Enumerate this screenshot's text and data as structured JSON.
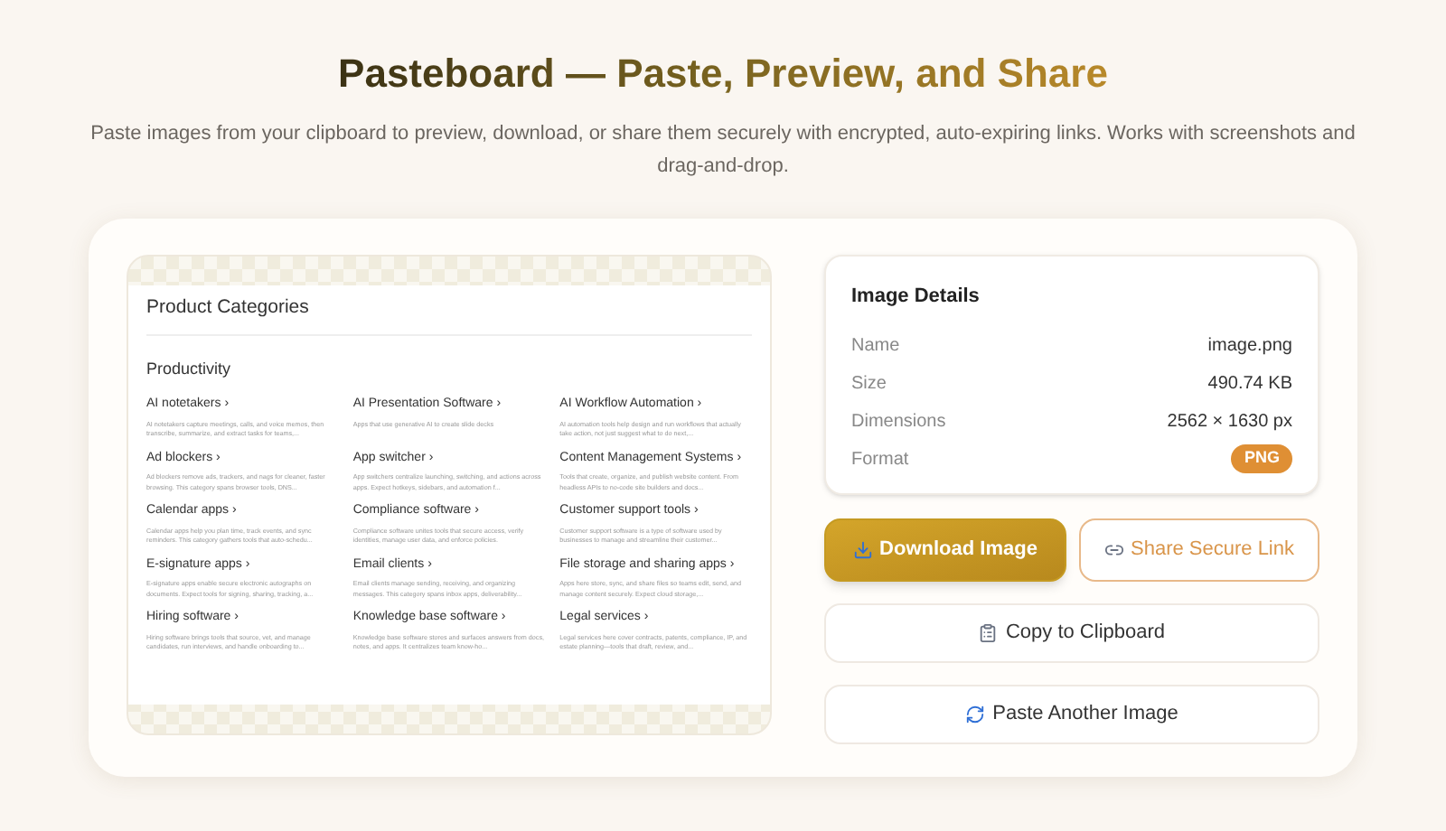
{
  "header": {
    "title": "Pasteboard — Paste, Preview, and Share",
    "subtitle": "Paste images from your clipboard to preview, download, or share them securely with encrypted, auto-expiring links. Works with screenshots and drag-and-drop."
  },
  "preview": {
    "title": "Product Categories",
    "section": "Productivity",
    "items": [
      {
        "name": "AI notetakers ›",
        "desc": "AI notetakers capture meetings, calls, and voice memos, then transcribe, summarize, and extract tasks for teams,..."
      },
      {
        "name": "AI Presentation Software ›",
        "desc": "Apps that use generative AI to create slide decks"
      },
      {
        "name": "AI Workflow Automation ›",
        "desc": "AI automation tools help design and run workflows that actually take action, not just suggest what to do next,..."
      },
      {
        "name": "Ad blockers ›",
        "desc": "Ad blockers remove ads, trackers, and nags for cleaner, faster browsing. This category spans browser tools, DNS..."
      },
      {
        "name": "App switcher ›",
        "desc": "App switchers centralize launching, switching, and actions across apps. Expect hotkeys, sidebars, and automation f..."
      },
      {
        "name": "Content Management Systems ›",
        "desc": "Tools that create, organize, and publish website content. From headless APIs to no-code site builders and docs..."
      },
      {
        "name": "Calendar apps ›",
        "desc": "Calendar apps help you plan time, track events, and sync reminders. This category gathers tools that auto-schedu..."
      },
      {
        "name": "Compliance software ›",
        "desc": "Compliance software unites tools that secure access, verify identities, manage user data, and enforce policies."
      },
      {
        "name": "Customer support tools ›",
        "desc": "Customer support software is a type of software used by businesses to manage and streamline their customer..."
      },
      {
        "name": "E-signature apps ›",
        "desc": "E-signature apps enable secure electronic autographs on documents. Expect tools for signing, sharing, tracking, a..."
      },
      {
        "name": "Email clients ›",
        "desc": "Email clients manage sending, receiving, and organizing messages. This category spans inbox apps, deliverability..."
      },
      {
        "name": "File storage and sharing apps ›",
        "desc": "Apps here store, sync, and share files so teams edit, send, and manage content securely. Expect cloud storage,..."
      },
      {
        "name": "Hiring software ›",
        "desc": "Hiring software brings tools that source, vet, and manage candidates, run interviews, and handle onboarding to..."
      },
      {
        "name": "Knowledge base software ›",
        "desc": "Knowledge base software stores and surfaces answers from docs, notes, and apps. It centralizes team know-ho..."
      },
      {
        "name": "Legal services ›",
        "desc": "Legal services here cover contracts, patents, compliance, IP, and estate planning—tools that draft, review, and..."
      }
    ]
  },
  "details": {
    "title": "Image Details",
    "rows": [
      {
        "label": "Name",
        "value": "image.png",
        "kind": "text"
      },
      {
        "label": "Size",
        "value": "490.74 KB",
        "kind": "text"
      },
      {
        "label": "Dimensions",
        "value": "2562 × 1630 px",
        "kind": "text"
      },
      {
        "label": "Format",
        "value": "PNG",
        "kind": "badge"
      }
    ]
  },
  "actions": [
    {
      "label": "Download Image",
      "kind": "primary"
    },
    {
      "label": "Share Secure Link",
      "kind": "outline"
    },
    {
      "label": "Copy to Clipboard",
      "kind": "plain"
    },
    {
      "label": "Paste Another Image",
      "kind": "plain"
    }
  ]
}
